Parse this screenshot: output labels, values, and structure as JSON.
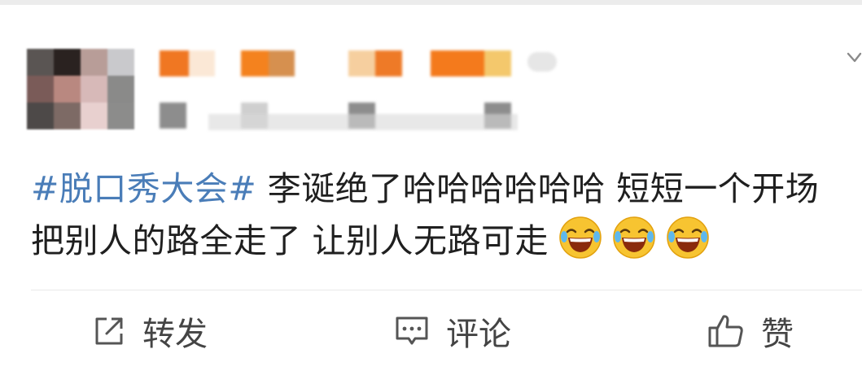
{
  "post": {
    "hashtag": "#脱口秀大会#",
    "text": " 李诞绝了哈哈哈哈哈哈 短短一个开场 把别人的路全走了 让别人无路可走",
    "emoji": [
      "laugh-cry-emoji",
      "laugh-cry-emoji",
      "laugh-cry-emoji"
    ]
  },
  "actions": {
    "repost_label": "转发",
    "comment_label": "评论",
    "like_label": "赞"
  },
  "icons": {
    "repost": "repost-icon",
    "comment": "comment-icon",
    "like": "thumbs-up-icon",
    "more": "chevron-down-icon"
  },
  "colors": {
    "hashtag": "#4a7db8",
    "text": "#1f1f1f",
    "action_text": "#444444",
    "divider": "#e9e9e9"
  }
}
